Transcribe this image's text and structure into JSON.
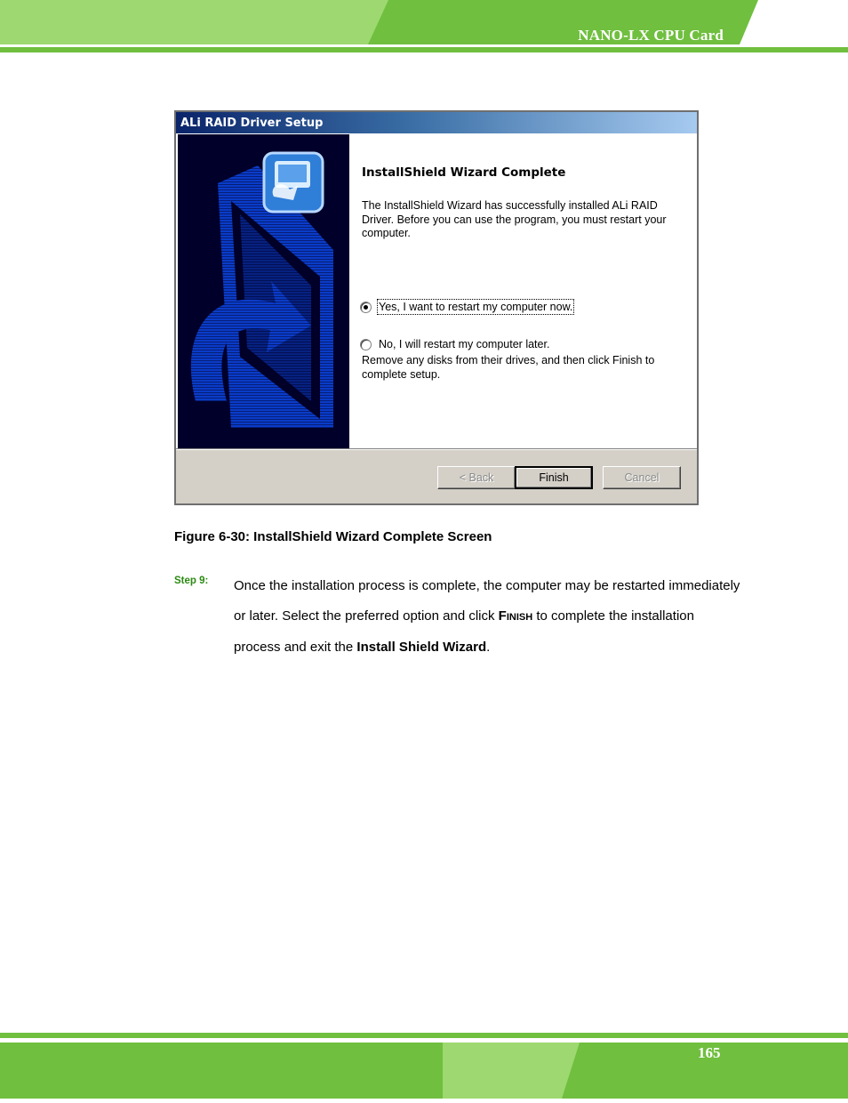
{
  "header": {
    "title": "NANO-LX CPU Card"
  },
  "dialog": {
    "title": "ALi RAID Driver Setup",
    "heading": "InstallShield Wizard Complete",
    "message": "The InstallShield Wizard has successfully installed ALi RAID Driver.  Before you can use the program, you must restart your computer.",
    "options": [
      {
        "label": "Yes, I want to restart my computer now.",
        "selected": true
      },
      {
        "label": "No, I will restart my computer later.",
        "selected": false
      }
    ],
    "note": "Remove any disks from their drives, and then click Finish to complete setup.",
    "buttons": {
      "back": "< Back",
      "finish": "Finish",
      "cancel": "Cancel"
    }
  },
  "caption": "Figure 6-30: InstallShield Wizard Complete Screen",
  "step": {
    "label": "Step 9:",
    "text_before": "Once the installation process is complete, the computer may be restarted immediately or later. Select the preferred option and click ",
    "finish_first": "F",
    "finish_rest": "INISH",
    "text_middle": " to complete the installation process and exit the ",
    "wizard_name": "Install Shield Wizard",
    "text_end": "."
  },
  "footer": {
    "page_number": "165"
  },
  "colors": {
    "accent_green": "#70bf3f",
    "light_green": "#9dd870",
    "step_green": "#2c8a12"
  }
}
